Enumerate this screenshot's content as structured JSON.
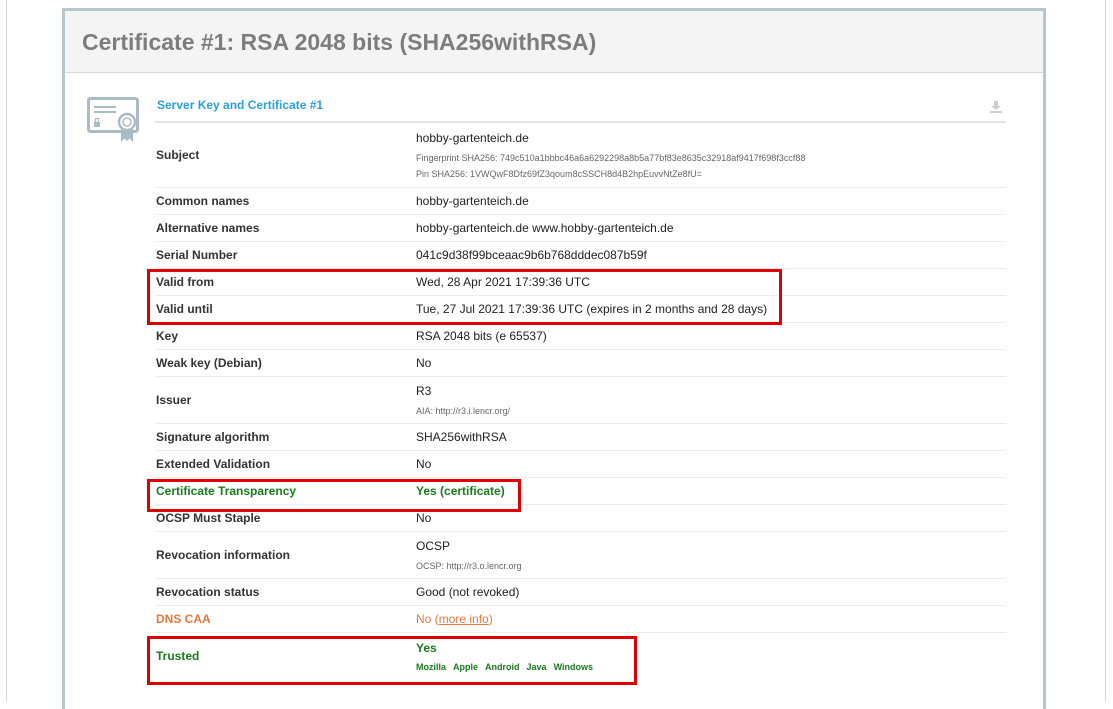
{
  "certificate": {
    "title": "Certificate #1: RSA 2048 bits (SHA256withRSA)",
    "section_title": "Server Key and Certificate #1",
    "subject": {
      "label": "Subject",
      "value": "hobby-gartenteich.de",
      "fingerprint": "Fingerprint SHA256: 749c510a1bbbc46a6a6292298a8b5a77bf83e8635c32918af9417f698f3ccf88",
      "pin": "Pin SHA256: 1VWQwF8Dfz69fZ3qoum8cSSCH8d4B2hpEuvvNtZe8fU="
    },
    "common_names": {
      "label": "Common names",
      "value": "hobby-gartenteich.de"
    },
    "alternative_names": {
      "label": "Alternative names",
      "value": "hobby-gartenteich.de www.hobby-gartenteich.de"
    },
    "serial_number": {
      "label": "Serial Number",
      "value": "041c9d38f99bceaac9b6b768dddec087b59f"
    },
    "valid_from": {
      "label": "Valid from",
      "value": "Wed, 28 Apr 2021 17:39:36 UTC"
    },
    "valid_until": {
      "label": "Valid until",
      "value": "Tue, 27 Jul 2021 17:39:36 UTC (expires in 2 months and 28 days)"
    },
    "key": {
      "label": "Key",
      "value": "RSA 2048 bits (e 65537)"
    },
    "weak_key": {
      "label": "Weak key (Debian)",
      "value": "No"
    },
    "issuer": {
      "label": "Issuer",
      "value": "R3",
      "aia": "AIA: http://r3.i.lencr.org/"
    },
    "signature_algorithm": {
      "label": "Signature algorithm",
      "value": "SHA256withRSA"
    },
    "extended_validation": {
      "label": "Extended Validation",
      "value": "No"
    },
    "certificate_transparency": {
      "label": "Certificate Transparency",
      "value": "Yes (certificate)"
    },
    "ocsp_must_staple": {
      "label": "OCSP Must Staple",
      "value": "No"
    },
    "revocation_information": {
      "label": "Revocation information",
      "value": "OCSP",
      "ocsp": "OCSP: http://r3.o.lencr.org"
    },
    "revocation_status": {
      "label": "Revocation status",
      "value": "Good (not revoked)"
    },
    "dns_caa": {
      "label": "DNS CAA",
      "value": "No",
      "open_paren": " (",
      "link": "more info",
      "close_paren": ")"
    },
    "trusted": {
      "label": "Trusted",
      "value": "Yes",
      "stores": [
        "Mozilla",
        "Apple",
        "Android",
        "Java",
        "Windows"
      ]
    }
  },
  "colors": {
    "accent_blue": "#2aa1d8",
    "ok_green": "#197c1c",
    "warn_orange": "#e5793c",
    "highlight_red": "#e00000"
  },
  "icons": {
    "certificate": "certificate-icon",
    "download": "download-icon"
  }
}
